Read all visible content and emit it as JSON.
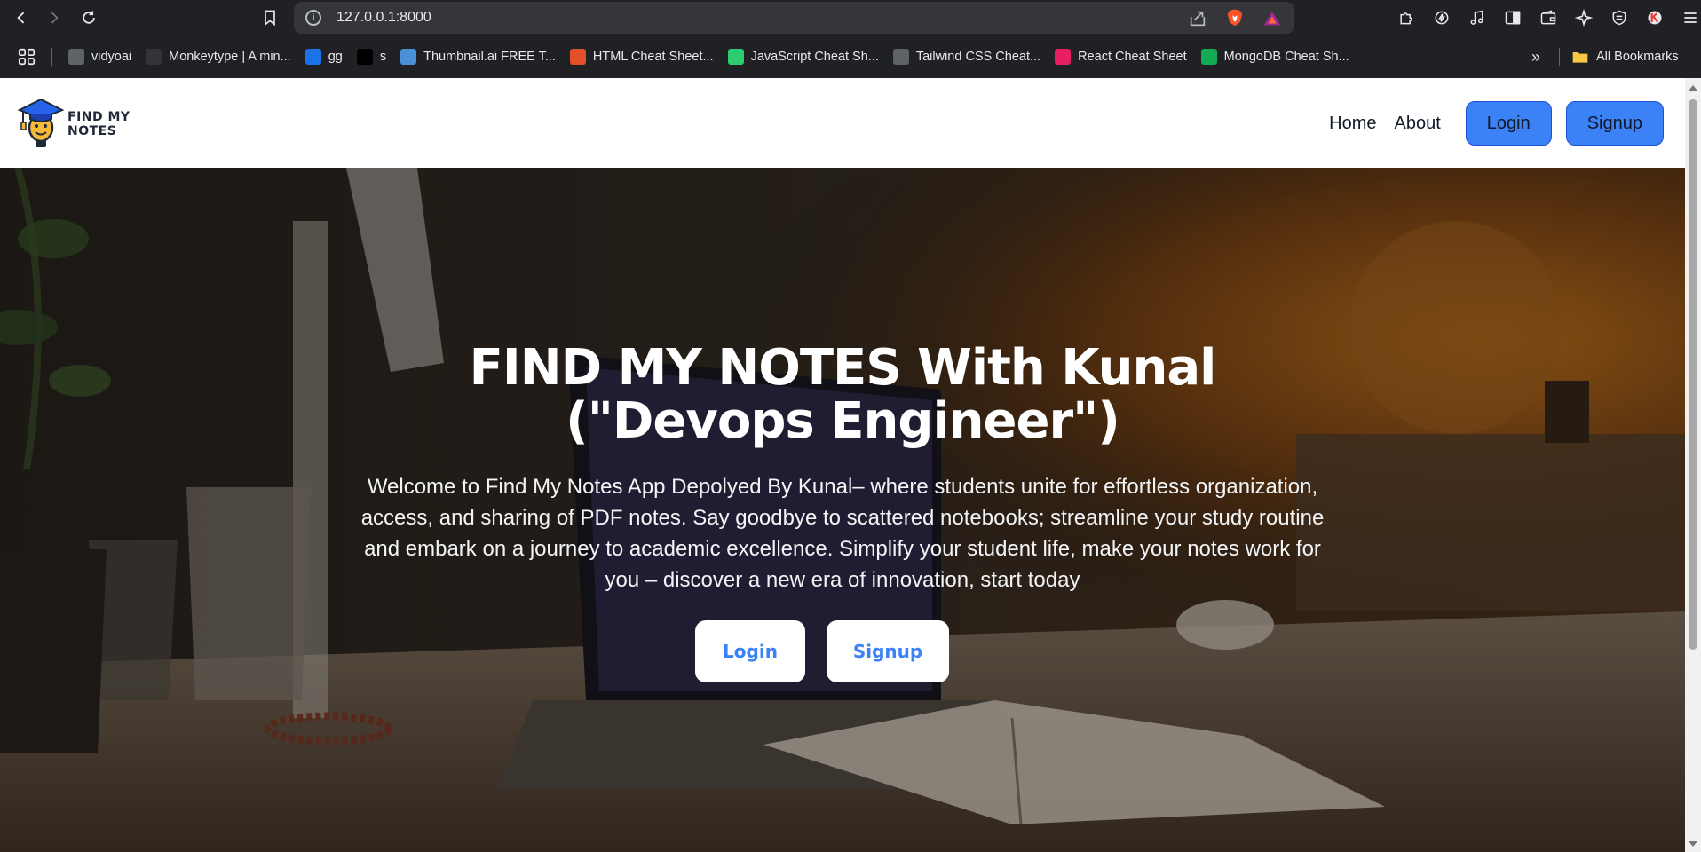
{
  "browser": {
    "url": "127.0.0.1:8000",
    "bookmarks": [
      {
        "label": "vidyoai",
        "icon": "globe-icon",
        "color": "#5f6368"
      },
      {
        "label": "Monkeytype | A min...",
        "icon": "monkeytype-icon",
        "color": "#323437"
      },
      {
        "label": "gg",
        "icon": "gg-icon",
        "color": "#1a73e8"
      },
      {
        "label": "s",
        "icon": "ampersand-icon",
        "color": "#000000"
      },
      {
        "label": "Thumbnail.ai FREE T...",
        "icon": "thumbnail-ai-icon",
        "color": "#4a90d9"
      },
      {
        "label": "HTML Cheat Sheet...",
        "icon": "html5-icon",
        "color": "#e34f26"
      },
      {
        "label": "JavaScript Cheat Sh...",
        "icon": "js-cheatsheet-icon",
        "color": "#2ecc71"
      },
      {
        "label": "Tailwind CSS Cheat...",
        "icon": "search-icon",
        "color": "#5f6368"
      },
      {
        "label": "React Cheat Sheet",
        "icon": "react-icon",
        "color": "#e91e63"
      },
      {
        "label": "MongoDB Cheat Sh...",
        "icon": "mongodb-leaf-icon",
        "color": "#13aa52"
      }
    ],
    "more_label": "»",
    "all_bookmarks_label": "All Bookmarks"
  },
  "site": {
    "logo_text_line1": "FIND MY",
    "logo_text_line2": "NOTES",
    "nav": {
      "home": "Home",
      "about": "About",
      "login": "Login",
      "signup": "Signup"
    },
    "hero": {
      "title": "FIND MY NOTES With Kunal (\"Devops Engineer\")",
      "description": "Welcome to Find My Notes App Depolyed By Kunal– where students unite for effortless organization, access, and sharing of PDF notes. Say goodbye to scattered notebooks; streamline your study routine and embark on a journey to academic excellence. Simplify your student life, make your notes work for you – discover a new era of innovation, start today",
      "login_button": "Login",
      "signup_button": "Signup"
    }
  },
  "colors": {
    "accent": "#3b82f6",
    "chrome_bg": "#202124",
    "urlbar_bg": "#35363a"
  }
}
